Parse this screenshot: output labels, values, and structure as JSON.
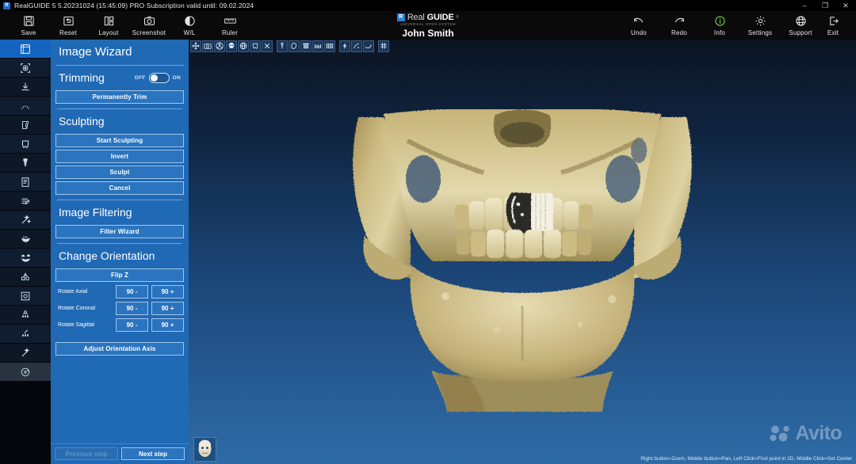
{
  "window": {
    "title": "RealGUIDE 5  5.20231024 (15:45:09)  PRO Subscription valid until: 09.02.2024",
    "app_icon": "realguide-icon",
    "minimize": "–",
    "maximize": "❐",
    "close": "✕"
  },
  "toolbar": {
    "left_tools": [
      {
        "label": "Save",
        "icon": "save-icon"
      },
      {
        "label": "Reset",
        "icon": "reset-icon"
      },
      {
        "label": "Layout",
        "icon": "layout-icon"
      },
      {
        "label": "Screenshot",
        "icon": "camera-icon"
      },
      {
        "label": "W/L",
        "icon": "contrast-icon"
      },
      {
        "label": "Ruler",
        "icon": "ruler-icon"
      }
    ],
    "right_tools": [
      {
        "label": "Undo",
        "icon": "undo-icon"
      },
      {
        "label": "Redo",
        "icon": "redo-icon"
      },
      {
        "label": "Info",
        "icon": "info-icon"
      },
      {
        "label": "Settings",
        "icon": "gear-icon"
      },
      {
        "label": "Support",
        "icon": "globe-icon"
      },
      {
        "label": "Exit",
        "icon": "exit-icon"
      }
    ]
  },
  "brand": {
    "mark": "R",
    "name_light": "Real",
    "name_bold": "GUIDE",
    "tm": "®",
    "subtitle": "UNIVERSAL OPEN SYSTEM",
    "patient": "John Smith"
  },
  "sidebar": {
    "items": [
      {
        "name": "sidebar-item-volume",
        "icon": "cube-icon",
        "active": true
      },
      {
        "name": "sidebar-item-align",
        "icon": "target-icon",
        "active": false
      },
      {
        "name": "sidebar-item-import",
        "icon": "import-icon",
        "active": false
      },
      {
        "name": "sidebar-item-arch",
        "icon": "arch-icon",
        "active": false
      },
      {
        "name": "sidebar-item-nerve",
        "icon": "panoramic-icon",
        "active": false
      },
      {
        "name": "sidebar-item-tooth",
        "icon": "tooth-icon",
        "active": false
      },
      {
        "name": "sidebar-item-implant",
        "icon": "implant-icon",
        "active": false
      },
      {
        "name": "sidebar-item-report",
        "icon": "report-icon",
        "active": false
      },
      {
        "name": "sidebar-item-notes",
        "icon": "notes-icon",
        "active": false
      },
      {
        "name": "sidebar-item-wand",
        "icon": "wand-icon",
        "active": false
      },
      {
        "name": "sidebar-item-smile-lower",
        "icon": "lower-jaw-icon",
        "active": false
      },
      {
        "name": "sidebar-item-smile-full",
        "icon": "full-arch-icon",
        "active": false
      },
      {
        "name": "sidebar-item-shapes",
        "icon": "shapes-icon",
        "active": false
      },
      {
        "name": "sidebar-item-frame",
        "icon": "frame-icon",
        "active": false
      },
      {
        "name": "sidebar-item-prosthesis",
        "icon": "prosthesis-icon",
        "active": false
      },
      {
        "name": "sidebar-item-bridge",
        "icon": "bridge-icon",
        "active": false
      },
      {
        "name": "sidebar-item-magic",
        "icon": "magic-wand-icon",
        "active": false
      },
      {
        "name": "sidebar-item-disc",
        "icon": "disc-icon",
        "active": false
      }
    ]
  },
  "wizard": {
    "title": "Image Wizard",
    "trimming": {
      "title": "Trimming",
      "off_label": "OFF",
      "on_label": "ON",
      "state": "off",
      "permanently_trim": "Permanently Trim"
    },
    "sculpting": {
      "title": "Sculpting",
      "buttons": [
        "Start Sculpting",
        "Invert",
        "Sculpt",
        "Cancel"
      ]
    },
    "filtering": {
      "title": "Image Filtering",
      "buttons": [
        "Filter Wizard"
      ]
    },
    "orientation": {
      "title": "Change Orientation",
      "flip_z": "Flip Z",
      "rows": [
        {
          "label": "Rotate Axial",
          "minus": "90 -",
          "plus": "90 +"
        },
        {
          "label": "Rotate Coronal",
          "minus": "90 -",
          "plus": "90 +"
        },
        {
          "label": "Rotate Sagittal",
          "minus": "90 -",
          "plus": "90 +"
        }
      ],
      "adjust": "Adjust Orientation Axis"
    },
    "footer": {
      "previous": "Previous step",
      "next": "Next step"
    }
  },
  "viewport": {
    "tools": [
      {
        "name": "pan-icon"
      },
      {
        "name": "camera-icon"
      },
      {
        "name": "radiation-icon"
      },
      {
        "name": "skull-icon"
      },
      {
        "name": "globe-view-icon"
      },
      {
        "name": "tooth-view-icon"
      },
      {
        "name": "close-icon"
      },
      {
        "name": "implant-body-icon"
      },
      {
        "name": "cut-plane-icon"
      },
      {
        "name": "abutment-icon"
      },
      {
        "name": "arch-lower-icon"
      },
      {
        "name": "arch-upper-icon"
      },
      {
        "name": "bolt-icon"
      },
      {
        "name": "curve-edit-icon"
      },
      {
        "name": "spline-icon"
      },
      {
        "name": "grid-icon"
      }
    ],
    "thumbnail": "orientation-head-thumbnail",
    "hint": "Right button=Zoom, Middle button=Pan, Left Click=Find point in 2D, Middle Click=Set Center",
    "watermark": "Avito",
    "render": "cbct-skull-3d-volume"
  },
  "colors": {
    "panel_blue": "#2069b5",
    "accent_blue": "#1565c0",
    "bone": "#c9b77a",
    "info_green": "#7ac943"
  }
}
